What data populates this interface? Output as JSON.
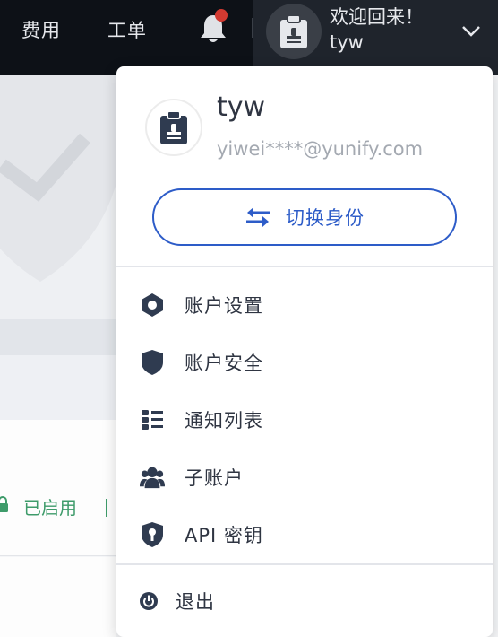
{
  "topbar": {
    "nav_items": [
      {
        "label": "费用"
      },
      {
        "label": "工单"
      }
    ],
    "notification": {
      "icon": "bell-icon",
      "has_unread": true,
      "badge_color": "#d33a31"
    },
    "user": {
      "welcome": "欢迎回来！",
      "username": "tyw",
      "avatar_icon": "id-badge-icon",
      "dropdown_icon": "chevron-down-icon"
    }
  },
  "background": {
    "status_text": "已启用",
    "status_icon": "lock-icon",
    "status_color": "#3e9b6a"
  },
  "dropdown": {
    "profile": {
      "name": "tyw",
      "email": "yiwei****@yunify.com",
      "avatar_icon": "id-badge-icon"
    },
    "switch_button": {
      "label": "切换身份",
      "icon": "swap-arrows-icon",
      "color": "#2d5cc8"
    },
    "menu_items": [
      {
        "label": "账户设置",
        "icon": "settings-hex-icon"
      },
      {
        "label": "账户安全",
        "icon": "shield-icon"
      },
      {
        "label": "通知列表",
        "icon": "list-icon"
      },
      {
        "label": "子账户",
        "icon": "users-icon"
      },
      {
        "label": "API 密钥",
        "icon": "key-shield-icon"
      }
    ],
    "logout": {
      "label": "退出",
      "icon": "power-icon"
    }
  }
}
